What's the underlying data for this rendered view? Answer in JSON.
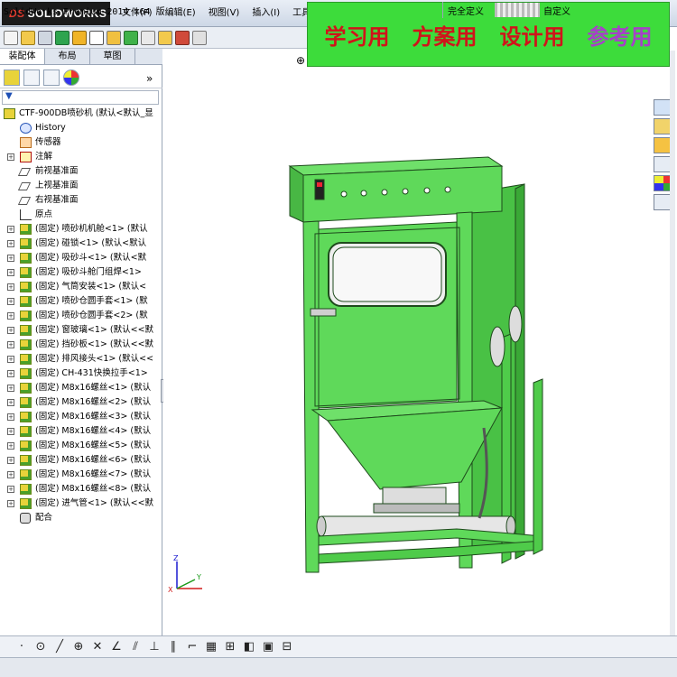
{
  "app": {
    "logo_text": "SOLIDWORKS",
    "logo_prefix": "DS"
  },
  "menu": [
    "文件(F)",
    "编辑(E)",
    "视图(V)",
    "插入(I)",
    "工具"
  ],
  "banner": {
    "items": [
      {
        "text": "学习用",
        "color": "#d0141a"
      },
      {
        "text": "方案用",
        "color": "#d0141a"
      },
      {
        "text": "设计用",
        "color": "#d0141a"
      },
      {
        "text": "参考用",
        "color": "#a641c8"
      }
    ],
    "background": "#3ddc3b"
  },
  "panel": {
    "tabs": [
      "装配体",
      "布局",
      "草图"
    ],
    "active_tab": "装配体",
    "expand_arrows": "»"
  },
  "tree": {
    "root": "CTF-900DB喷砂机  (默认<默认_显",
    "items": [
      {
        "label": "History",
        "icon": "history"
      },
      {
        "label": "传感器",
        "icon": "sensor"
      },
      {
        "label": "注解",
        "icon": "annotation",
        "expandable": true
      },
      {
        "label": "前视基准面",
        "icon": "plane"
      },
      {
        "label": "上视基准面",
        "icon": "plane"
      },
      {
        "label": "右视基准面",
        "icon": "plane"
      },
      {
        "label": "原点",
        "icon": "origin"
      },
      {
        "label": "(固定) 喷砂机机舱<1> (默认",
        "icon": "part",
        "expandable": true
      },
      {
        "label": "(固定) 碰锁<1> (默认<默认",
        "icon": "part",
        "expandable": true
      },
      {
        "label": "(固定) 吸砂斗<1> (默认<默",
        "icon": "part",
        "expandable": true
      },
      {
        "label": "(固定) 吸砂斗舱门组焊<1>",
        "icon": "part",
        "expandable": true
      },
      {
        "label": "(固定) 气筒安装<1> (默认<",
        "icon": "part",
        "expandable": true
      },
      {
        "label": "(固定) 喷砂仓圆手套<1> (默",
        "icon": "part",
        "expandable": true
      },
      {
        "label": "(固定) 喷砂仓圆手套<2> (默",
        "icon": "part",
        "expandable": true
      },
      {
        "label": "(固定) 窗玻璃<1> (默认<<默",
        "icon": "part",
        "expandable": true
      },
      {
        "label": "(固定) 挡砂板<1> (默认<<默",
        "icon": "part",
        "expandable": true
      },
      {
        "label": "(固定) 排风接头<1> (默认<<",
        "icon": "part",
        "expandable": true
      },
      {
        "label": "(固定) CH-431快换拉手<1>",
        "icon": "part",
        "expandable": true
      },
      {
        "label": "(固定) M8x16螺丝<1> (默认",
        "icon": "part",
        "expandable": true
      },
      {
        "label": "(固定) M8x16螺丝<2> (默认",
        "icon": "part",
        "expandable": true
      },
      {
        "label": "(固定) M8x16螺丝<3> (默认",
        "icon": "part",
        "expandable": true
      },
      {
        "label": "(固定) M8x16螺丝<4> (默认",
        "icon": "part",
        "expandable": true
      },
      {
        "label": "(固定) M8x16螺丝<5> (默认",
        "icon": "part",
        "expandable": true
      },
      {
        "label": "(固定) M8x16螺丝<6> (默认",
        "icon": "part",
        "expandable": true
      },
      {
        "label": "(固定) M8x16螺丝<7> (默认",
        "icon": "part",
        "expandable": true
      },
      {
        "label": "(固定) M8x16螺丝<8> (默认",
        "icon": "part",
        "expandable": true
      },
      {
        "label": "(固定) 进气管<1> (默认<<默",
        "icon": "part",
        "expandable": true
      },
      {
        "label": "配合",
        "icon": "mate"
      }
    ]
  },
  "triad": {
    "x": "X",
    "y": "Y",
    "z": "Z"
  },
  "status": {
    "app_version": "SolidWorks Premium 2014 x64 版",
    "definition": "完全定义",
    "units": "自定义"
  },
  "colors": {
    "model_green": "#5fd95a",
    "model_dark": "#2a7a28",
    "panel_border": "#9aa6b8"
  }
}
